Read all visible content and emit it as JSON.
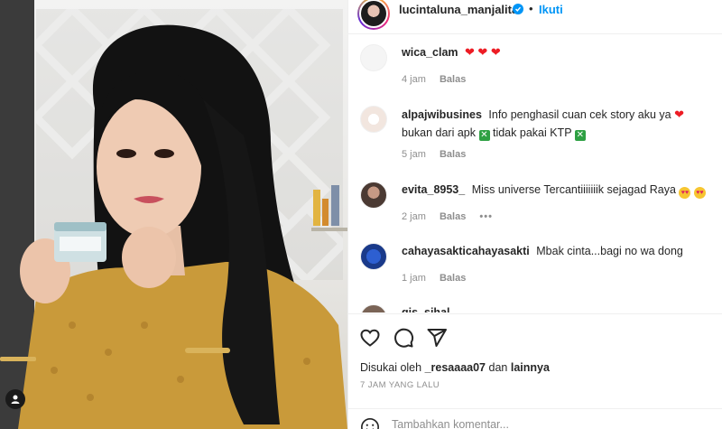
{
  "post": {
    "username": "lucintaluna_manjalita",
    "separator": "•",
    "follow_label": "Ikuti"
  },
  "comments": [
    {
      "username": "wica_clam",
      "text": "",
      "time": "4 jam",
      "reply": "Balas"
    },
    {
      "username": "alpajwibusines",
      "text": "Info penghasil cuan cek story aku ya",
      "text2": "bukan dari apk",
      "text3": "tidak pakai KTP",
      "time": "5 jam",
      "reply": "Balas"
    },
    {
      "username": "evita_8953_",
      "text": "Miss universe Tercantiiiiiiik sejagad Raya",
      "time": "2 jam",
      "reply": "Balas",
      "more": "•••"
    },
    {
      "username": "cahayasakticahayasakti",
      "text": "Mbak cinta...bagi no wa dong",
      "time": "1 jam",
      "reply": "Balas"
    },
    {
      "username": "gis_sihal"
    }
  ],
  "likes": {
    "prefix": "Disukai oleh",
    "user": "_resaaaa07",
    "conj": "dan",
    "others": "lainnya"
  },
  "timestamp": "7 JAM YANG LALU",
  "composer": {
    "placeholder": "Tambahkan komentar..."
  },
  "colors": {
    "accent": "#0095f6",
    "text": "#262626",
    "muted": "#8e8e8e",
    "divider": "#efefef"
  },
  "icons": [
    "heart-icon",
    "comment-icon",
    "share-icon",
    "emoji-icon",
    "verified-icon",
    "user-tag-icon"
  ]
}
